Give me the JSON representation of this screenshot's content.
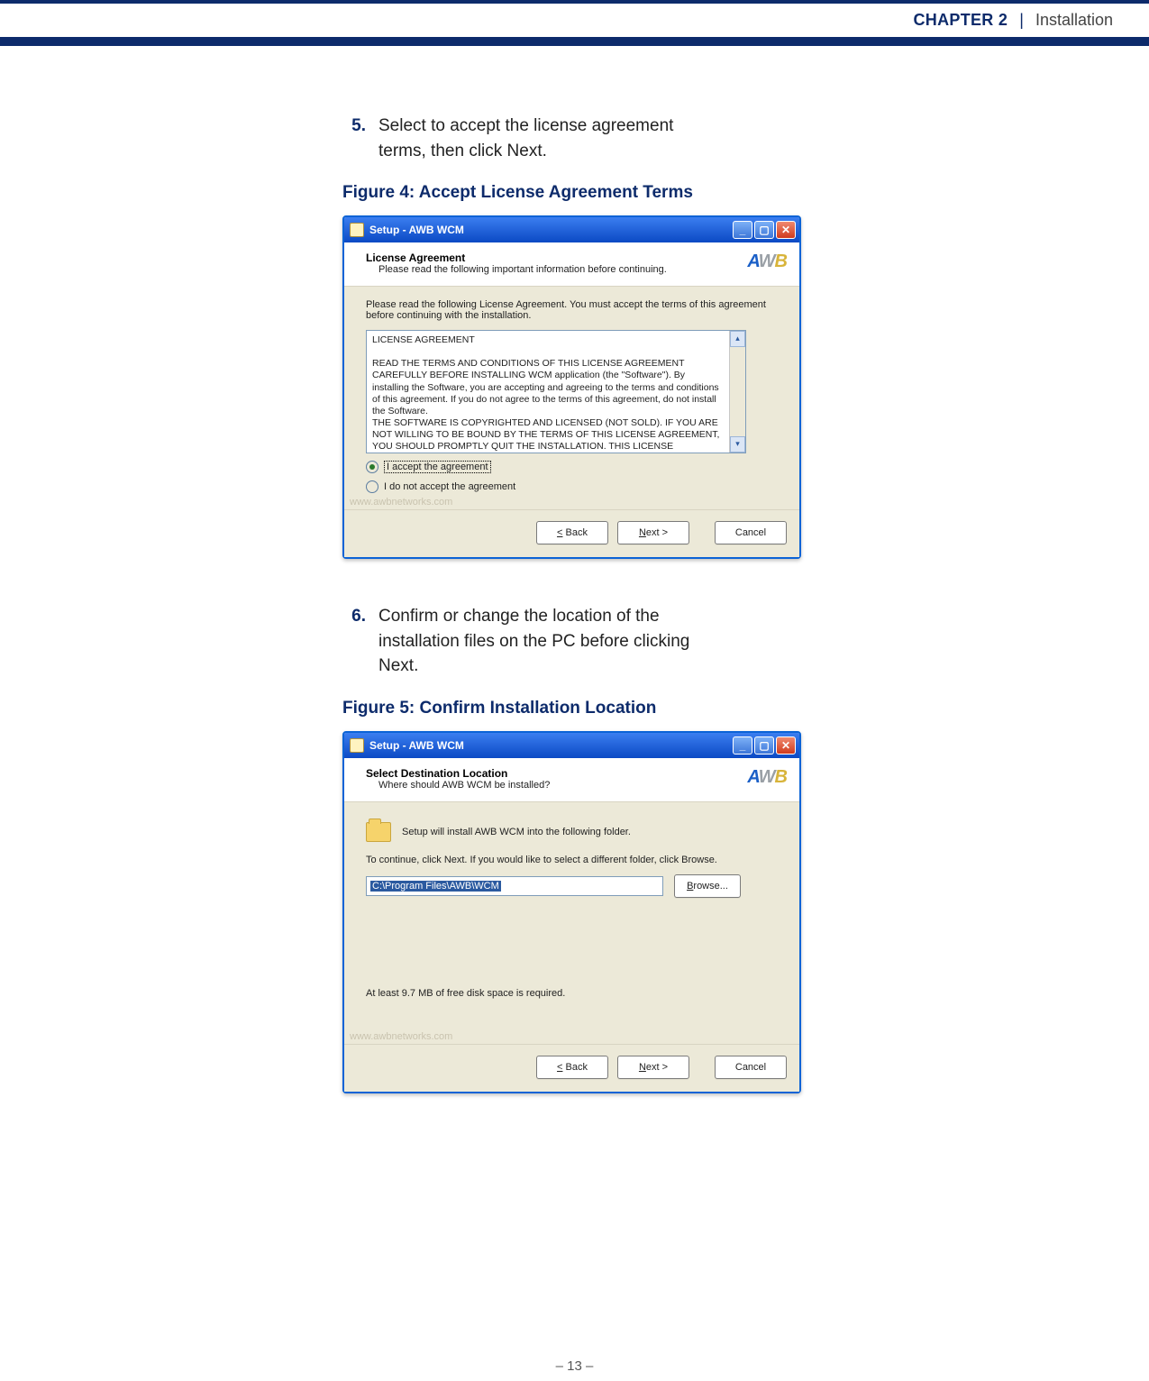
{
  "header": {
    "chapter": "CHAPTER 2",
    "separator": "|",
    "title": "Installation"
  },
  "steps": {
    "s5": {
      "num": "5.",
      "text": "Select to accept the license agreement terms, then click Next."
    },
    "s6": {
      "num": "6.",
      "text": "Confirm or change the location of the installation files on the PC before clicking Next."
    }
  },
  "figures": {
    "f4": "Figure 4:  Accept License Agreement Terms",
    "f5": "Figure 5:  Confirm Installation Location"
  },
  "dialog": {
    "window_title": "Setup - AWB WCM",
    "logo": {
      "l1": "A",
      "l2": "W",
      "l3": "B"
    },
    "watermark": "www.awbnetworks.com",
    "buttons": {
      "back": "< Back",
      "next": "Next >",
      "cancel": "Cancel",
      "browse": "Browse..."
    }
  },
  "dlg1": {
    "head_title": "License Agreement",
    "head_sub": "Please read the following important information before continuing.",
    "intro": "Please read the following License Agreement. You must accept the terms of this agreement before continuing with the installation.",
    "license_line1": "LICENSE AGREEMENT",
    "license_body": "READ THE TERMS AND CONDITIONS OF THIS LICENSE AGREEMENT CAREFULLY BEFORE INSTALLING WCM application  (the \"Software\").  By installing the Software, you are accepting and agreeing to the terms and conditions of this agreement. If you do not agree to the terms of this agreement, do not install the Software.\nTHE SOFTWARE IS COPYRIGHTED AND LICENSED (NOT SOLD). IF YOU ARE NOT WILLING TO BE BOUND BY THE TERMS OF THIS LICENSE AGREEMENT, YOU SHOULD PROMPTLY QUIT THE INSTALLATION.  THIS LICENSE AGREEMENT",
    "radio_accept": "I accept the agreement",
    "radio_decline": "I do not accept the agreement"
  },
  "dlg2": {
    "head_title": "Select Destination Location",
    "head_sub": "Where should AWB WCM be installed?",
    "folder_note": "Setup will install AWB WCM into the following folder.",
    "continue_note": "To continue, click Next. If you would like to select a different folder, click Browse.",
    "path": "C:\\Program Files\\AWB\\WCM",
    "disk": "At least 9.7 MB of free disk space is required."
  },
  "footer": {
    "page": "–  13  –"
  }
}
